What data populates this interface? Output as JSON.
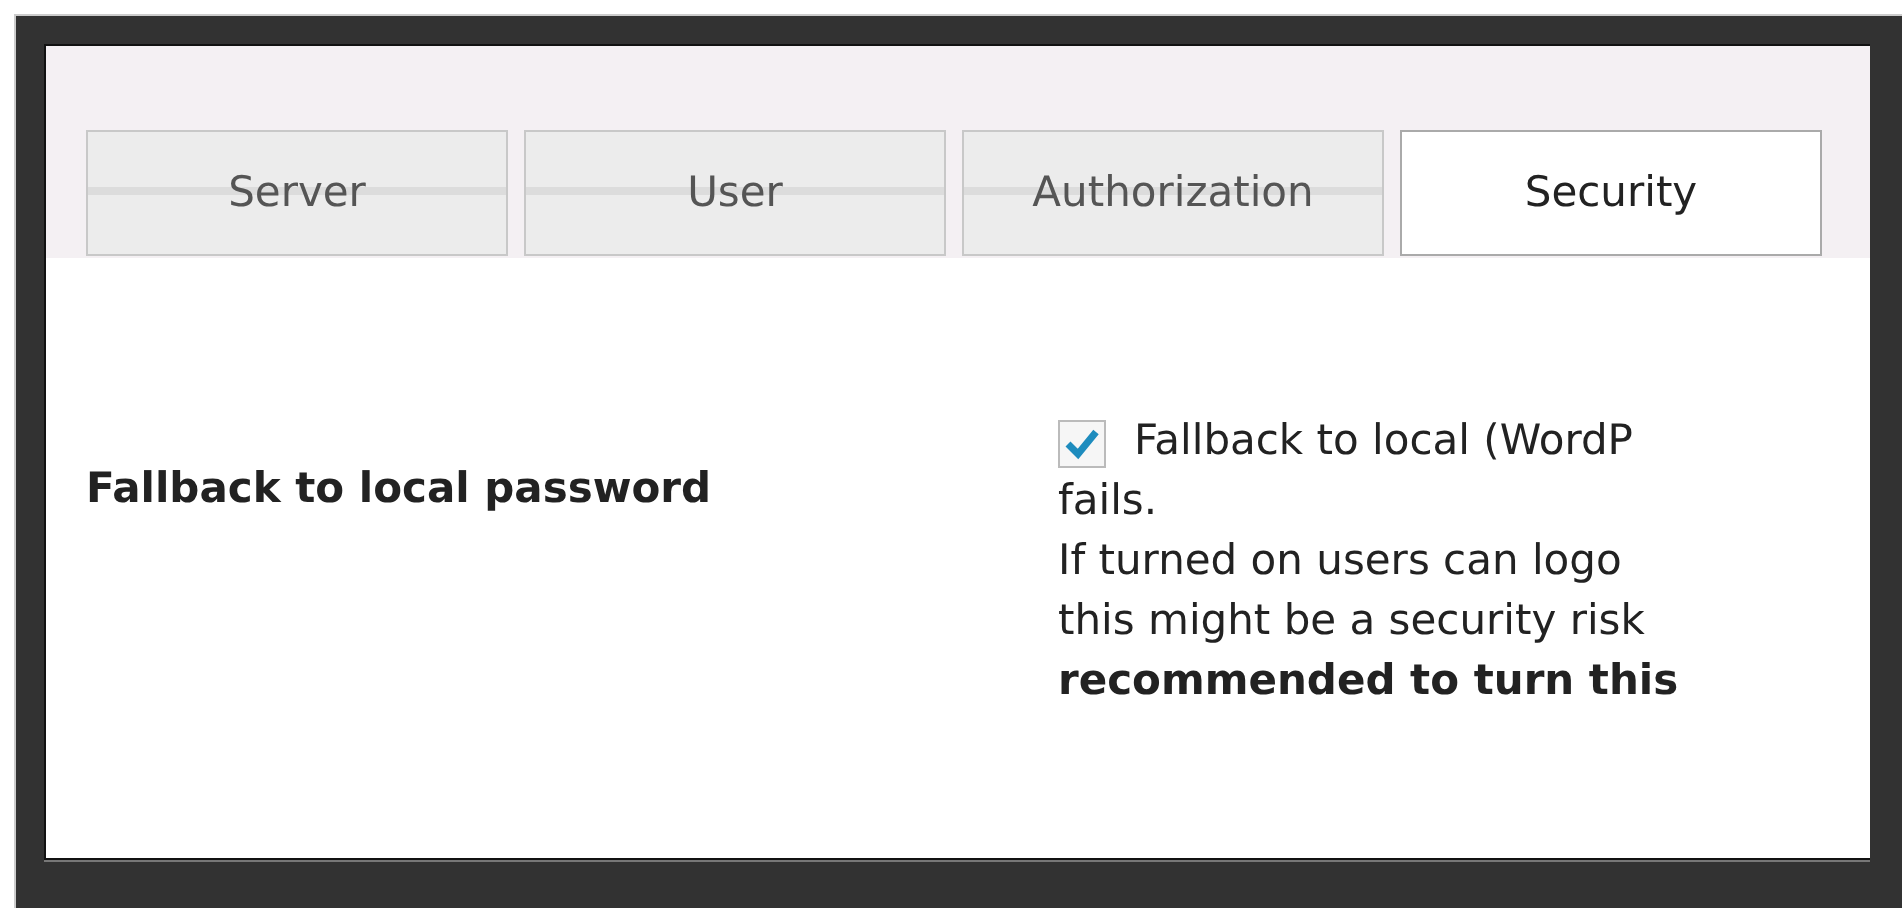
{
  "tabs": [
    {
      "label": "Server",
      "selected": false
    },
    {
      "label": "User",
      "selected": false
    },
    {
      "label": "Authorization",
      "selected": false
    },
    {
      "label": "Security",
      "selected": true
    }
  ],
  "setting": {
    "label": "Fallback to local password",
    "checked": true,
    "option_lines": [
      "Fallback to local (WordP",
      "fails."
    ],
    "description_lines": [
      {
        "text": "If turned on users can logo",
        "bold": false
      },
      {
        "text": "this might be a security risk",
        "bold": false
      },
      {
        "text": "recommended to turn this",
        "bold": true
      }
    ]
  }
}
